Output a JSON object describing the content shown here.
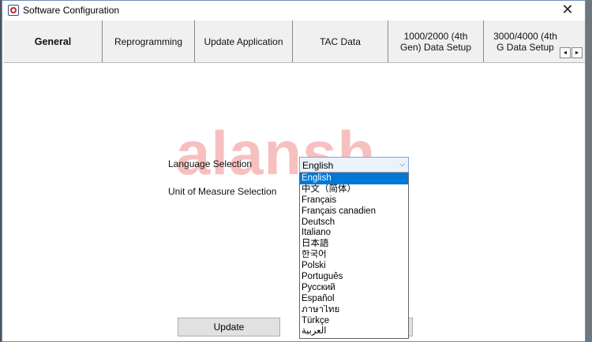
{
  "window": {
    "title": "Software Configuration",
    "close_glyph": "✕"
  },
  "tabs": [
    {
      "label": "General"
    },
    {
      "label": "Reprogramming"
    },
    {
      "label": "Update Application"
    },
    {
      "label": "TAC Data"
    },
    {
      "label": "1000/2000 (4th Gen) Data Setup"
    },
    {
      "label": "3000/4000 (4th G Data Setup"
    }
  ],
  "tab_scroll": {
    "left_glyph": "◂",
    "right_glyph": "▸"
  },
  "watermark": "alansh",
  "form": {
    "language_label": "Language Selection",
    "unit_label": "Unit of Measure Selection",
    "language_value": "English",
    "chevron_glyph": "⌵"
  },
  "language_options": [
    "English",
    "中文（简体）",
    "Français",
    "Français canadien",
    "Deutsch",
    "Italiano",
    "日本語",
    "한국어",
    "Polski",
    "Português",
    "Русский",
    "Español",
    "ภาษาไทย",
    "Türkçe",
    "العربية"
  ],
  "selected_index": 0,
  "buttons": {
    "update": "Update"
  },
  "colors": {
    "selection": "#0078d7",
    "tab_bg": "#f0f0f0",
    "watermark": "#f08c8c"
  }
}
